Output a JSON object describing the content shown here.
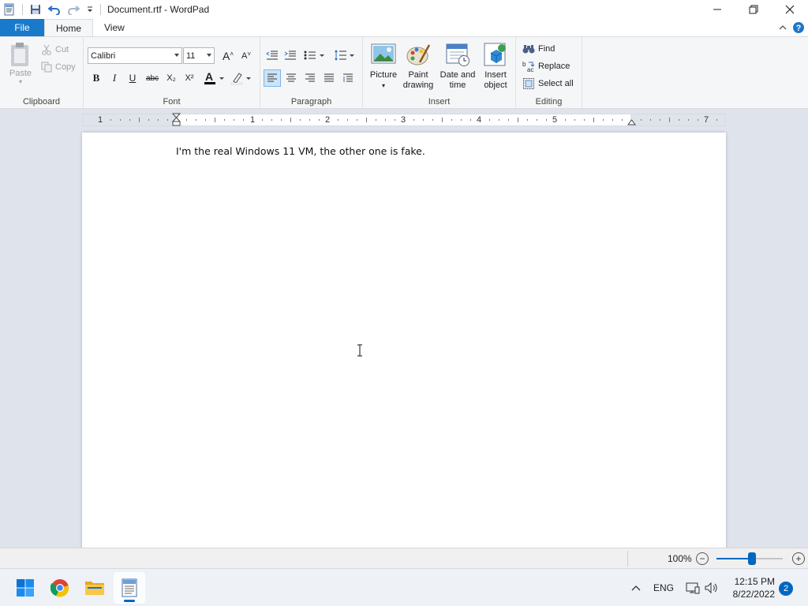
{
  "window": {
    "title": "Document.rtf - WordPad"
  },
  "tabs": {
    "file": "File",
    "home": "Home",
    "view": "View"
  },
  "ribbon": {
    "clipboard": {
      "label": "Clipboard",
      "paste": "Paste",
      "cut": "Cut",
      "copy": "Copy"
    },
    "font": {
      "label": "Font",
      "family": "Calibri",
      "size": "11",
      "bold": "B",
      "italic": "I",
      "underline": "U",
      "strikethrough": "abc",
      "subscript": "X₂",
      "superscript": "X²"
    },
    "paragraph": {
      "label": "Paragraph"
    },
    "insert": {
      "label": "Insert",
      "picture": "Picture",
      "paint_drawing_1": "Paint",
      "paint_drawing_2": "drawing",
      "date_time_1": "Date and",
      "date_time_2": "time",
      "insert_object_1": "Insert",
      "insert_object_2": "object"
    },
    "editing": {
      "label": "Editing",
      "find": "Find",
      "replace": "Replace",
      "select_all": "Select all"
    }
  },
  "ruler": {
    "numbers": [
      "1",
      "1",
      "2",
      "3",
      "4",
      "5",
      "7"
    ]
  },
  "document": {
    "text": "I'm the real Windows 11 VM, the other one is fake."
  },
  "statusbar": {
    "zoom": "100%",
    "zoom_level_percent": 50,
    "zoom_out": "−",
    "zoom_in": "+"
  },
  "taskbar": {
    "apps": [
      "start",
      "chrome",
      "file-explorer",
      "wordpad"
    ],
    "active_app": "wordpad",
    "language": "ENG",
    "time": "12:15 PM",
    "date": "8/22/2022",
    "notifications": "2"
  },
  "colors": {
    "accent": "#1979ca",
    "ribbon_bg": "#f5f6f7",
    "workspace_bg": "#dee3ec",
    "taskbar_bg": "#eef1f6"
  }
}
